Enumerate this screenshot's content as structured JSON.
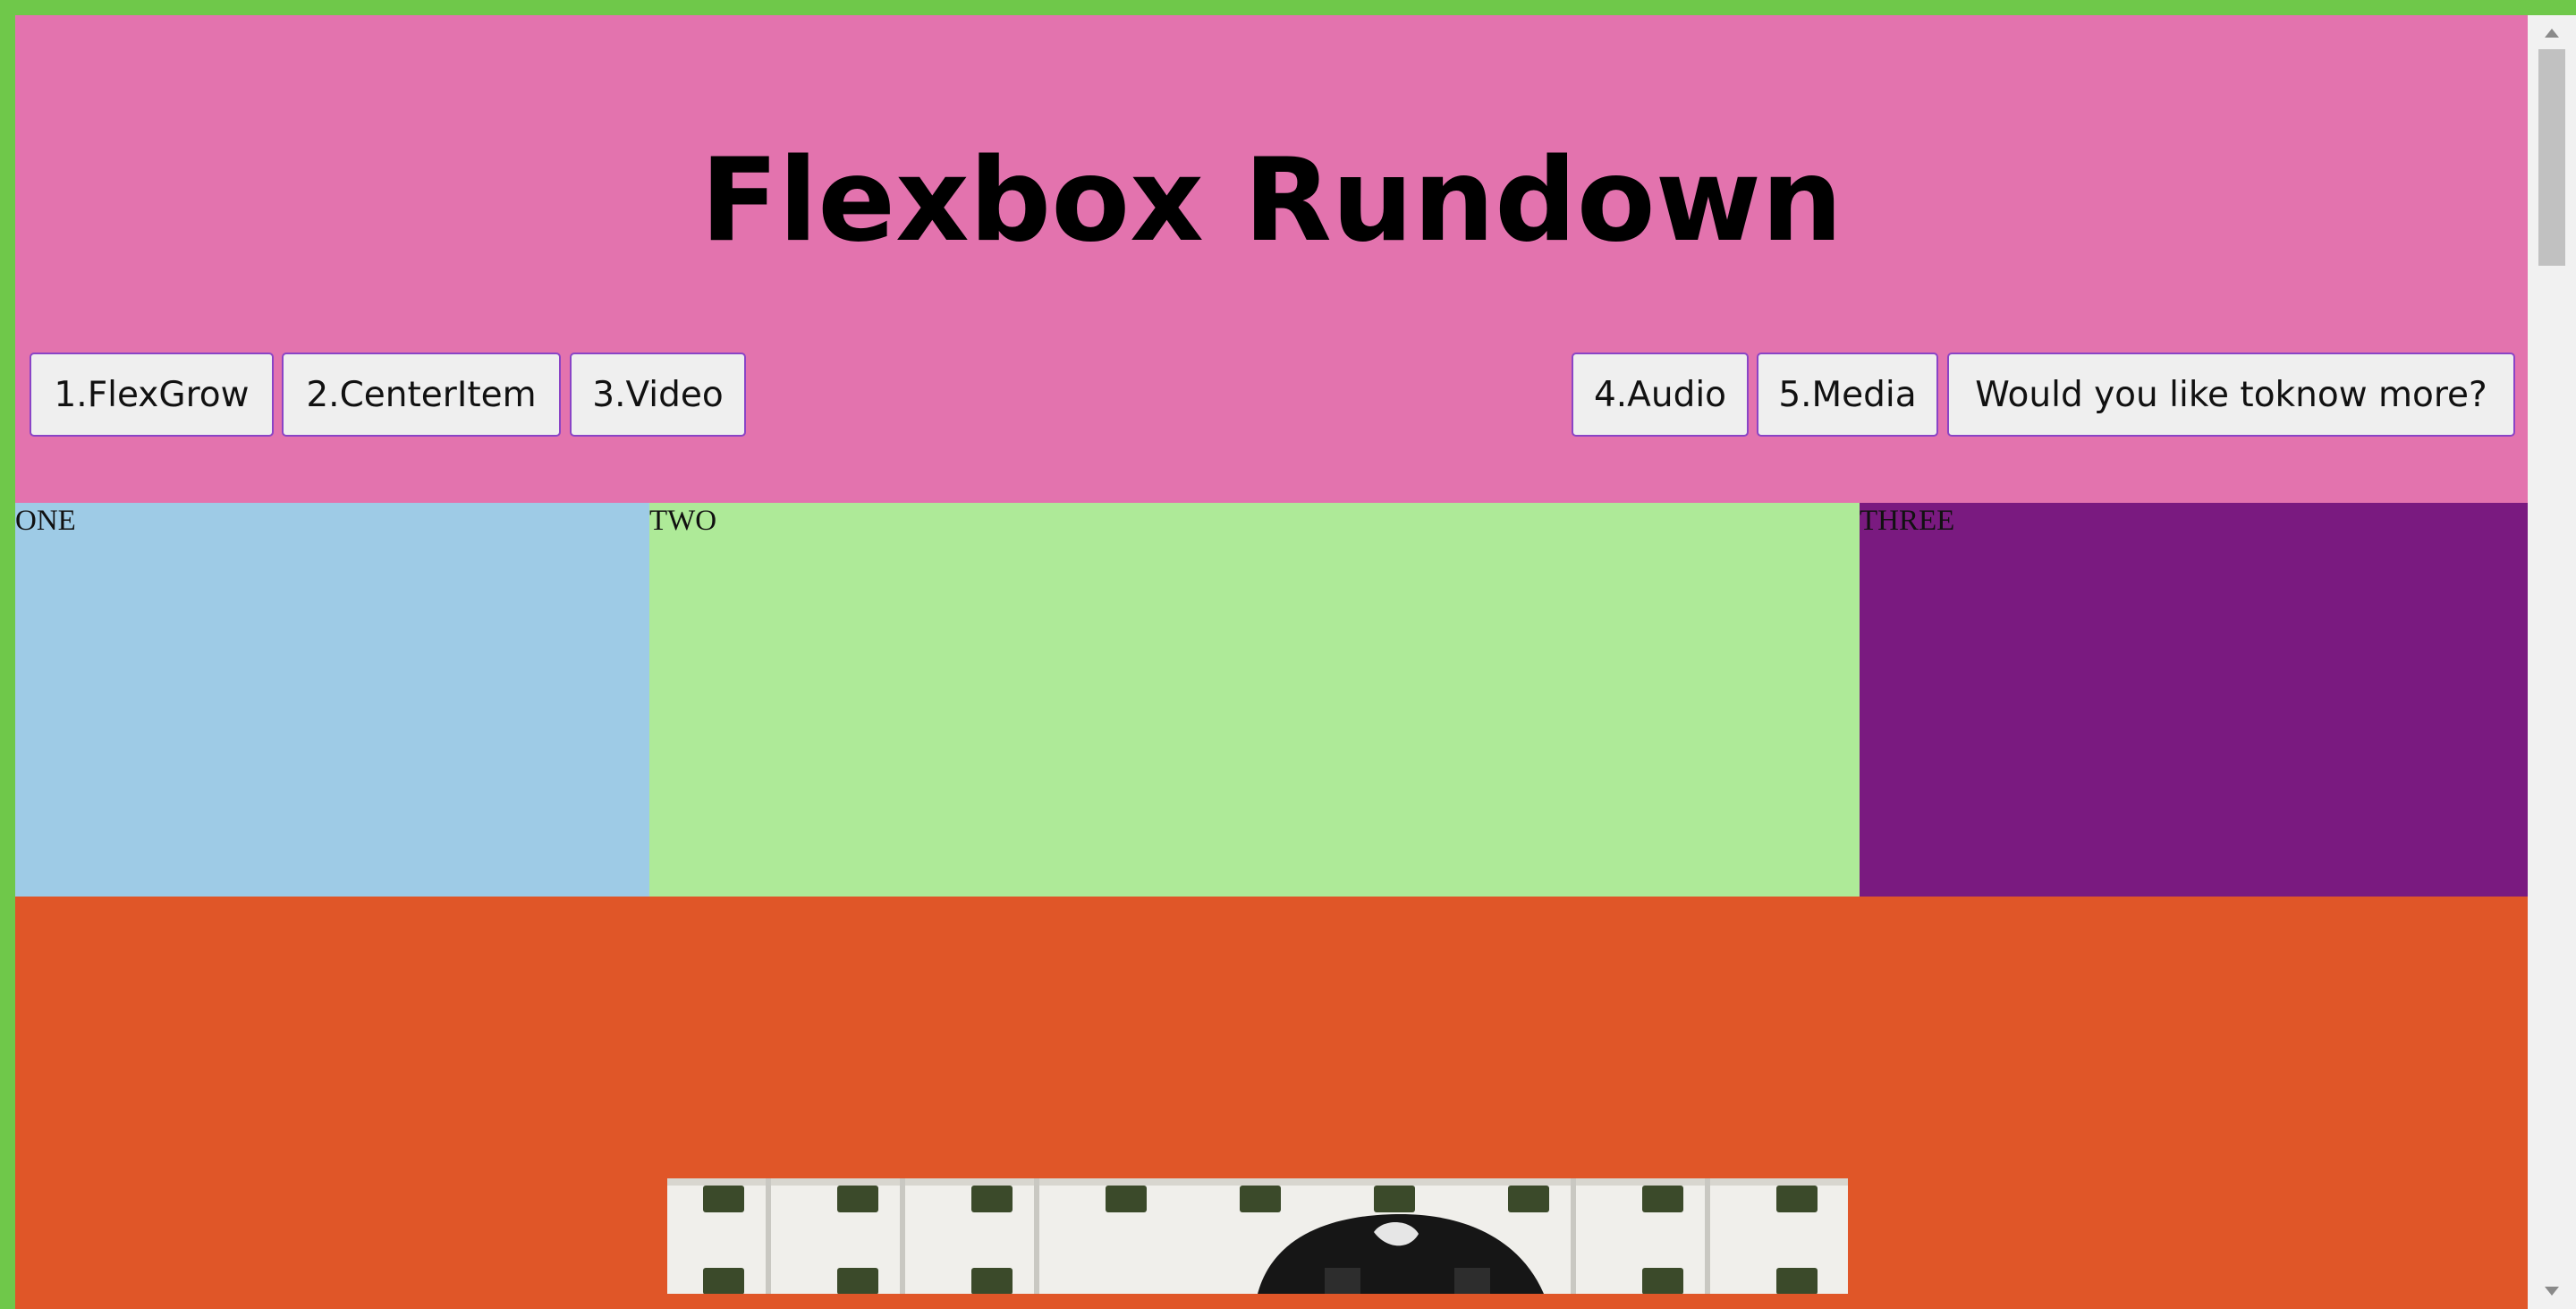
{
  "page": {
    "title": "Flexbox Rundown"
  },
  "nav": {
    "left": [
      {
        "label": "1.FlexGrow"
      },
      {
        "label": "2.CenterItem"
      },
      {
        "label": "3.Video"
      }
    ],
    "right": [
      {
        "label": "4.Audio"
      },
      {
        "label": "5.Media"
      },
      {
        "label": "Would you like toknow more?"
      }
    ]
  },
  "boxes": [
    {
      "label": "ONE",
      "color": "#9ecbe6"
    },
    {
      "label": "TWO",
      "color": "#aeea98"
    },
    {
      "label": "THREE",
      "color": "#7a1a80"
    }
  ],
  "colors": {
    "page_border": "#6fc84a",
    "header_bg": "#e373ae",
    "media_section_bg": "#e05628",
    "button_border": "#8a44c6"
  },
  "media": {
    "image_subject": "dog photo"
  }
}
